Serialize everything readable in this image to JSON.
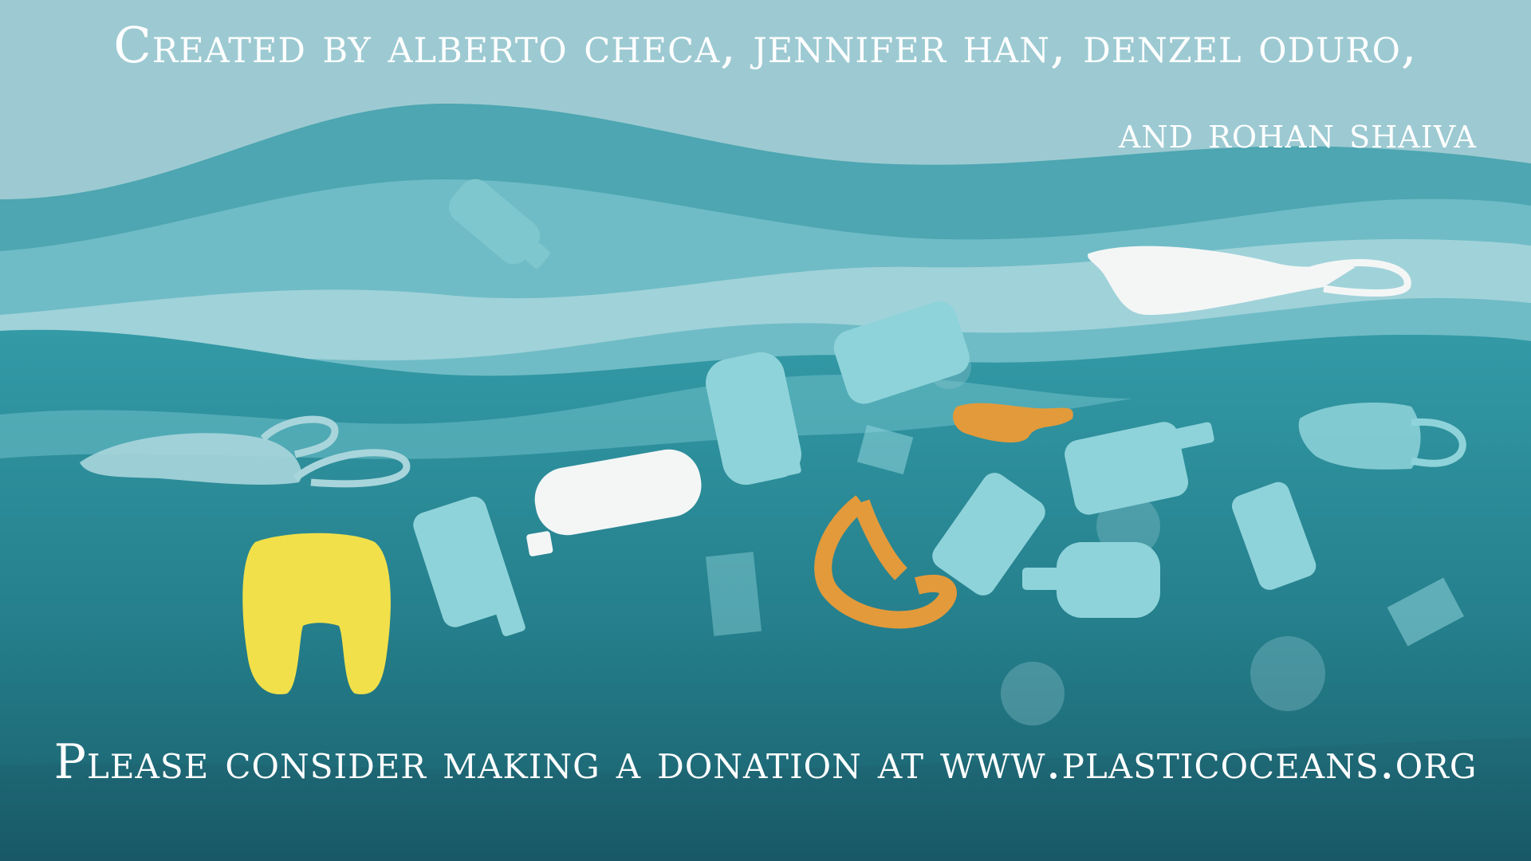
{
  "credits": {
    "line1": "Created by alberto checa, jennifer han, denzel oduro,",
    "line2": "and rohan shaiva"
  },
  "donation": {
    "text": "Please consider making a donation at www.plasticoceans.org"
  },
  "palette": {
    "sky": "#9dcad2",
    "wave_light": "#6fbcc6",
    "wave_foam": "#a9d6dc",
    "sea_upper": "#2f8e9a",
    "sea_deep": "#1d6572",
    "plastic_blue": "#8fd3da",
    "plastic_white": "#f4f6f6",
    "bag_yellow": "#f1e04a",
    "bag_orange": "#e39a3b"
  }
}
